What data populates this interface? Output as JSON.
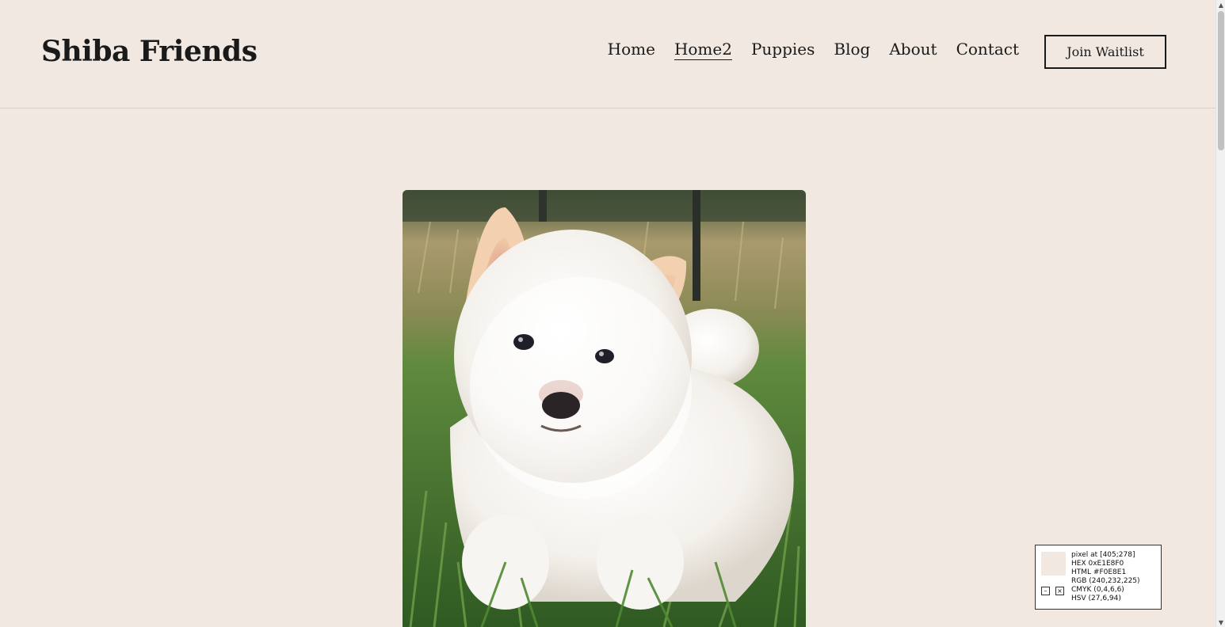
{
  "header": {
    "logo": "Shiba Friends",
    "nav": [
      "Home",
      "Home2",
      "Puppies",
      "Blog",
      "About",
      "Contact"
    ],
    "active_nav": "Home2",
    "cta_label": "Join Waitlist"
  },
  "hero": {
    "image_icon": "white-shiba-puppy-photo"
  },
  "color_picker": {
    "lines": [
      "pixel at [405;278]",
      "HEX 0xE1E8F0",
      "HTML #F0E8E1",
      "RGB (240,232,225)",
      "CMYK (0,4,6,6)",
      "HSV (27,6,94)"
    ],
    "minimize": "–",
    "close": "×",
    "swatch_color": "#F0E8E1"
  },
  "colors": {
    "background": "#f0e8e1",
    "text": "#1a1a1a"
  }
}
